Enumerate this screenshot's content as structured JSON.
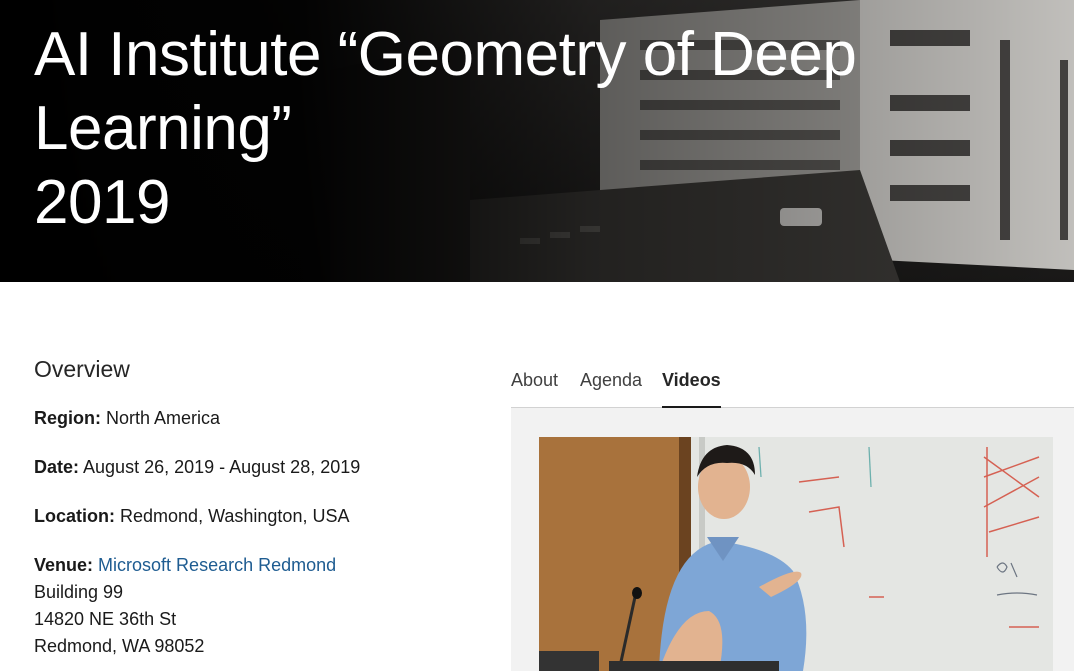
{
  "hero": {
    "title_line1": "AI Institute “Geometry of Deep Learning”",
    "title_line2": "2019"
  },
  "overview": {
    "heading": "Overview",
    "region_label": "Region:",
    "region_value": "North America",
    "date_label": "Date:",
    "date_value": "August 26, 2019 - August 28, 2019",
    "location_label": "Location:",
    "location_value": "Redmond, Washington, USA",
    "venue_label": "Venue:",
    "venue_link": "Microsoft Research Redmond",
    "address": [
      "Building 99",
      "14820 NE 36th St",
      "Redmond, WA 98052"
    ]
  },
  "tabs": [
    {
      "label": "About",
      "active": false
    },
    {
      "label": "Agenda",
      "active": false
    },
    {
      "label": "Videos",
      "active": true
    }
  ],
  "colors": {
    "link": "#1e5c91",
    "tab_underline": "#1a1a1a",
    "panel_bg": "#f2f2f2"
  }
}
